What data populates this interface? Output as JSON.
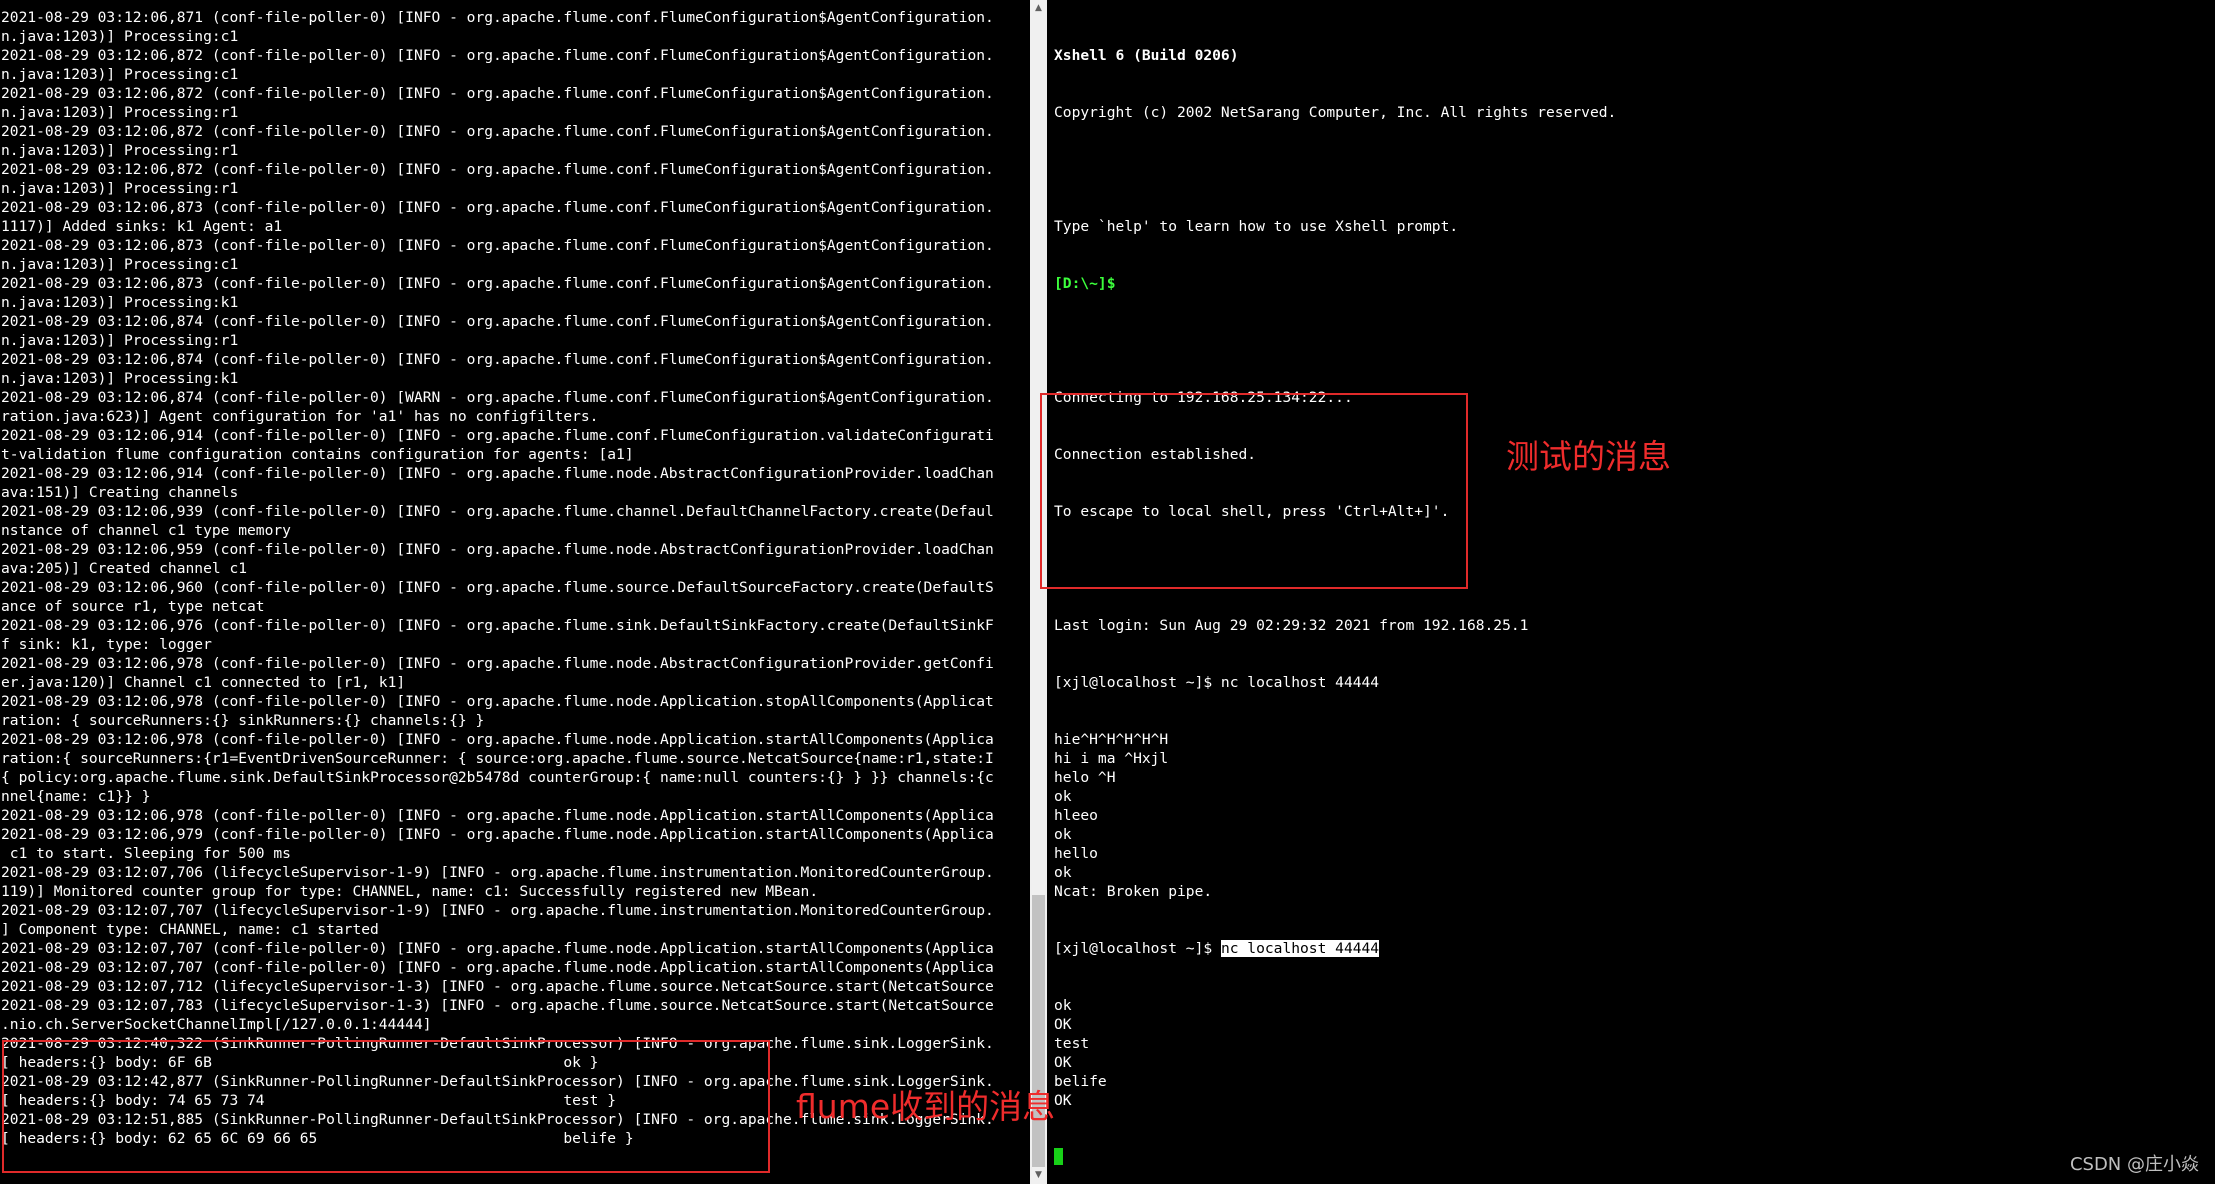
{
  "left_terminal": {
    "lines": [
      "2021-08-29 03:12:06,871 (conf-file-poller-0) [INFO - org.apache.flume.conf.FlumeConfiguration$AgentConfiguration.",
      "n.java:1203)] Processing:c1",
      "2021-08-29 03:12:06,872 (conf-file-poller-0) [INFO - org.apache.flume.conf.FlumeConfiguration$AgentConfiguration.",
      "n.java:1203)] Processing:c1",
      "2021-08-29 03:12:06,872 (conf-file-poller-0) [INFO - org.apache.flume.conf.FlumeConfiguration$AgentConfiguration.",
      "n.java:1203)] Processing:r1",
      "2021-08-29 03:12:06,872 (conf-file-poller-0) [INFO - org.apache.flume.conf.FlumeConfiguration$AgentConfiguration.",
      "n.java:1203)] Processing:r1",
      "2021-08-29 03:12:06,872 (conf-file-poller-0) [INFO - org.apache.flume.conf.FlumeConfiguration$AgentConfiguration.",
      "n.java:1203)] Processing:r1",
      "2021-08-29 03:12:06,873 (conf-file-poller-0) [INFO - org.apache.flume.conf.FlumeConfiguration$AgentConfiguration.",
      "1117)] Added sinks: k1 Agent: a1",
      "2021-08-29 03:12:06,873 (conf-file-poller-0) [INFO - org.apache.flume.conf.FlumeConfiguration$AgentConfiguration.",
      "n.java:1203)] Processing:c1",
      "2021-08-29 03:12:06,873 (conf-file-poller-0) [INFO - org.apache.flume.conf.FlumeConfiguration$AgentConfiguration.",
      "n.java:1203)] Processing:k1",
      "2021-08-29 03:12:06,874 (conf-file-poller-0) [INFO - org.apache.flume.conf.FlumeConfiguration$AgentConfiguration.",
      "n.java:1203)] Processing:r1",
      "2021-08-29 03:12:06,874 (conf-file-poller-0) [INFO - org.apache.flume.conf.FlumeConfiguration$AgentConfiguration.",
      "n.java:1203)] Processing:k1",
      "2021-08-29 03:12:06,874 (conf-file-poller-0) [WARN - org.apache.flume.conf.FlumeConfiguration$AgentConfiguration.",
      "ration.java:623)] Agent configuration for 'a1' has no configfilters.",
      "2021-08-29 03:12:06,914 (conf-file-poller-0) [INFO - org.apache.flume.conf.FlumeConfiguration.validateConfigurati",
      "t-validation flume configuration contains configuration for agents: [a1]",
      "2021-08-29 03:12:06,914 (conf-file-poller-0) [INFO - org.apache.flume.node.AbstractConfigurationProvider.loadChan",
      "ava:151)] Creating channels",
      "2021-08-29 03:12:06,939 (conf-file-poller-0) [INFO - org.apache.flume.channel.DefaultChannelFactory.create(Defaul",
      "nstance of channel c1 type memory",
      "2021-08-29 03:12:06,959 (conf-file-poller-0) [INFO - org.apache.flume.node.AbstractConfigurationProvider.loadChan",
      "ava:205)] Created channel c1",
      "2021-08-29 03:12:06,960 (conf-file-poller-0) [INFO - org.apache.flume.source.DefaultSourceFactory.create(DefaultS",
      "ance of source r1, type netcat",
      "2021-08-29 03:12:06,976 (conf-file-poller-0) [INFO - org.apache.flume.sink.DefaultSinkFactory.create(DefaultSinkF",
      "f sink: k1, type: logger",
      "2021-08-29 03:12:06,978 (conf-file-poller-0) [INFO - org.apache.flume.node.AbstractConfigurationProvider.getConfi",
      "er.java:120)] Channel c1 connected to [r1, k1]",
      "2021-08-29 03:12:06,978 (conf-file-poller-0) [INFO - org.apache.flume.node.Application.stopAllComponents(Applicat",
      "ration: { sourceRunners:{} sinkRunners:{} channels:{} }",
      "2021-08-29 03:12:06,978 (conf-file-poller-0) [INFO - org.apache.flume.node.Application.startAllComponents(Applica",
      "ration:{ sourceRunners:{r1=EventDrivenSourceRunner: { source:org.apache.flume.source.NetcatSource{name:r1,state:I",
      "{ policy:org.apache.flume.sink.DefaultSinkProcessor@2b5478d counterGroup:{ name:null counters:{} } }} channels:{c",
      "nnel{name: c1}} }",
      "2021-08-29 03:12:06,978 (conf-file-poller-0) [INFO - org.apache.flume.node.Application.startAllComponents(Applica",
      "2021-08-29 03:12:06,979 (conf-file-poller-0) [INFO - org.apache.flume.node.Application.startAllComponents(Applica",
      " c1 to start. Sleeping for 500 ms",
      "2021-08-29 03:12:07,706 (lifecycleSupervisor-1-9) [INFO - org.apache.flume.instrumentation.MonitoredCounterGroup.",
      "119)] Monitored counter group for type: CHANNEL, name: c1: Successfully registered new MBean.",
      "2021-08-29 03:12:07,707 (lifecycleSupervisor-1-9) [INFO - org.apache.flume.instrumentation.MonitoredCounterGroup.",
      "] Component type: CHANNEL, name: c1 started",
      "2021-08-29 03:12:07,707 (conf-file-poller-0) [INFO - org.apache.flume.node.Application.startAllComponents(Applica",
      "2021-08-29 03:12:07,707 (conf-file-poller-0) [INFO - org.apache.flume.node.Application.startAllComponents(Applica",
      "2021-08-29 03:12:07,712 (lifecycleSupervisor-1-3) [INFO - org.apache.flume.source.NetcatSource.start(NetcatSource",
      "2021-08-29 03:12:07,783 (lifecycleSupervisor-1-3) [INFO - org.apache.flume.source.NetcatSource.start(NetcatSource",
      ".nio.ch.ServerSocketChannelImpl[/127.0.0.1:44444]",
      "2021-08-29 03:12:40,322 (SinkRunner-PollingRunner-DefaultSinkProcessor) [INFO - org.apache.flume.sink.LoggerSink.",
      "[ headers:{} body: 6F 6B                                        ok }",
      "2021-08-29 03:12:42,877 (SinkRunner-PollingRunner-DefaultSinkProcessor) [INFO - org.apache.flume.sink.LoggerSink.",
      "[ headers:{} body: 74 65 73 74                                  test }",
      "2021-08-29 03:12:51,885 (SinkRunner-PollingRunner-DefaultSinkProcessor) [INFO - org.apache.flume.sink.LoggerSink.",
      "[ headers:{} body: 62 65 6C 69 66 65                            belife }"
    ]
  },
  "right_terminal": {
    "banner_title": "Xshell 6 (Build 0206)",
    "banner_copyright": "Copyright (c) 2002 NetSarang Computer, Inc. All rights reserved.",
    "help_text": "Type `help' to learn how to use Xshell prompt.",
    "local_prompt": "[D:\\~]$",
    "connecting": "Connecting to 192.168.25.134:22...",
    "established": "Connection established.",
    "escape_hint": "To escape to local shell, press 'Ctrl+Alt+]'.",
    "last_login": "Last login: Sun Aug 29 02:29:32 2021 from 192.168.25.1",
    "first_command": "[xjl@localhost ~]$ nc localhost 44444",
    "session1_lines": [
      "hie^H^H^H^H^H",
      "hi i ma ^Hxjl",
      "helo ^H",
      "ok",
      "hleeo",
      "ok",
      "hello",
      "ok",
      "Ncat: Broken pipe."
    ],
    "prompt2": "[xjl@localhost ~]$ ",
    "command2": "nc localhost 44444",
    "session2_lines": [
      "ok",
      "OK",
      "test",
      "OK",
      "belife",
      "OK"
    ]
  },
  "annotations": {
    "right_label": "测试的消息",
    "left_label": "flume收到的消息"
  },
  "scrollbar": {
    "up_arrow": "▲",
    "down_arrow": "▼"
  },
  "watermark": "CSDN @庄小焱",
  "colors": {
    "background": "#000000",
    "text": "#ffffff",
    "prompt_green": "#3cff3c",
    "cursor": "#18d018",
    "annotation_red": "#e02a2a"
  }
}
